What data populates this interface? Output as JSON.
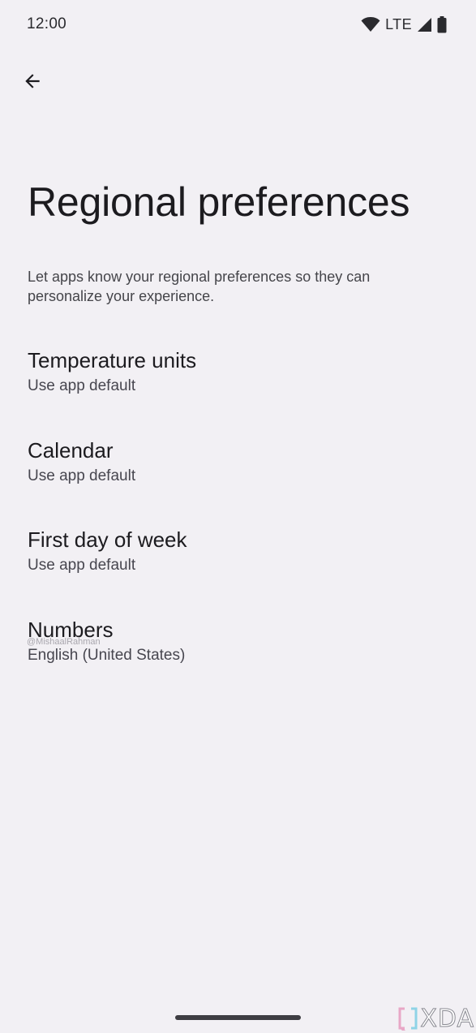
{
  "status_bar": {
    "time": "12:00",
    "network_label": "LTE",
    "icons": [
      "wifi-icon",
      "signal-icon",
      "battery-icon"
    ]
  },
  "header": {
    "back_icon": "arrow-back-icon"
  },
  "page": {
    "title": "Regional preferences",
    "description": "Let apps know your regional preferences so they can personalize your experience."
  },
  "preferences": [
    {
      "title": "Temperature units",
      "summary": "Use app default"
    },
    {
      "title": "Calendar",
      "summary": "Use app default"
    },
    {
      "title": "First day of week",
      "summary": "Use app default"
    },
    {
      "title": "Numbers",
      "summary": "English (United States)"
    }
  ],
  "watermark": {
    "handle": "@MishaalRahman",
    "brand": "XDA"
  },
  "colors": {
    "background": "#f2f0f4",
    "text_primary": "#1c1b1f",
    "text_secondary": "#47464f",
    "nav_handle": "#3e3d42"
  }
}
